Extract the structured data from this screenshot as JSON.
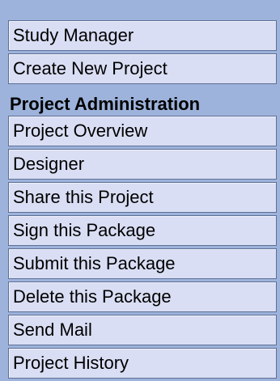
{
  "nav_top": {
    "items": [
      {
        "label": "Study Manager"
      },
      {
        "label": "Create New Project"
      }
    ]
  },
  "admin": {
    "heading": "Project Administration",
    "items": [
      {
        "label": "Project Overview"
      },
      {
        "label": "Designer"
      },
      {
        "label": "Share this Project"
      },
      {
        "label": "Sign this Package"
      },
      {
        "label": "Submit this Package"
      },
      {
        "label": "Delete this Package"
      },
      {
        "label": "Send Mail"
      },
      {
        "label": "Project History"
      }
    ]
  },
  "colors": {
    "background": "#9db3db",
    "item_background": "#d9def4",
    "item_border": "#5e6f95",
    "text": "#000000"
  }
}
